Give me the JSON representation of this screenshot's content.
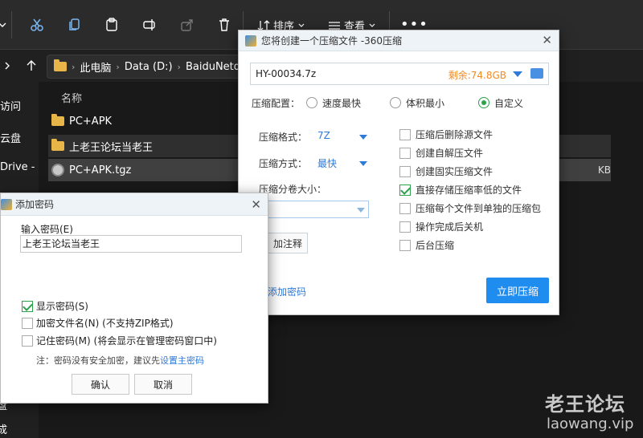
{
  "toolbar": {
    "sort_label": "排序",
    "view_label": "查看",
    "more_label": "•••"
  },
  "address": {
    "segments": [
      "此电脑",
      "Data (D:)",
      "BaiduNetdisk"
    ]
  },
  "sidebar": {
    "items": [
      "访问",
      "云盘",
      "Drive - P",
      "",
      "",
      "",
      "",
      "",
      "",
      "",
      "盘",
      "成"
    ]
  },
  "content": {
    "column_name": "名称",
    "files": [
      {
        "name": "PC+APK",
        "type": "folder",
        "size": ""
      },
      {
        "name": "上老王论坛当老王",
        "type": "folder",
        "size": ""
      },
      {
        "name": "PC+APK.tgz",
        "type": "archive",
        "size": "KB"
      }
    ]
  },
  "watermark": {
    "cn": "老王论坛",
    "en": "laowang.vip"
  },
  "zip_dialog": {
    "title": "您将创建一个压缩文件 -360压缩",
    "close": "✕",
    "path": "HY-00034.7z",
    "free_space": "剩余:74.8GB",
    "config_label": "压缩配置：",
    "config_options": [
      "速度最快",
      "体积最小",
      "自定义"
    ],
    "config_selected": 2,
    "format_label": "压缩格式：",
    "format_value": "7Z",
    "method_label": "压缩方式：",
    "method_value": "最快",
    "split_label": "压缩分卷大小：",
    "note_button": "加注释",
    "add_password": "添加密码",
    "compress_button": "立即压缩",
    "options": [
      {
        "label": "压缩后删除源文件",
        "checked": false
      },
      {
        "label": "创建自解压文件",
        "checked": false
      },
      {
        "label": "创建固实压缩文件",
        "checked": false
      },
      {
        "label": "直接存储压缩率低的文件",
        "checked": true
      },
      {
        "label": "压缩每个文件到单独的压缩包",
        "checked": false
      },
      {
        "label": "操作完成后关机",
        "checked": false
      },
      {
        "label": "后台压缩",
        "checked": false
      }
    ]
  },
  "pwd_dialog": {
    "title": "添加密码",
    "close": "✕",
    "input_label": "输入密码(E)",
    "input_value": "上老王论坛当老王",
    "checks": [
      {
        "label": "显示密码(S)",
        "checked": true
      },
      {
        "label": "加密文件名(N) (不支持ZIP格式)",
        "checked": false
      },
      {
        "label": "记住密码(M) (将会显示在管理密码窗口中)",
        "checked": false
      }
    ],
    "note_prefix": "注：密码没有安全加密，建议先",
    "note_link": "设置主密码",
    "ok": "确认",
    "cancel": "取消"
  }
}
